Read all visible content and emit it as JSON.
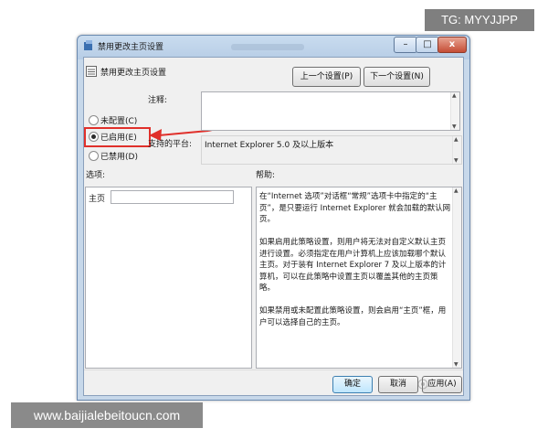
{
  "watermarks": {
    "tag": "TG: MYYJJPP",
    "url": "www.baijialebeitoucn.com"
  },
  "window": {
    "title": "禁用更改主页设置",
    "controls": {
      "minimize": "–",
      "maximize": "□",
      "close": "x"
    }
  },
  "policy": {
    "name": "禁用更改主页设置",
    "prev_button": "上一个设置(P)",
    "next_button": "下一个设置(N)"
  },
  "state": {
    "options": [
      {
        "label": "未配置(C)",
        "selected": false
      },
      {
        "label": "已启用(E)",
        "selected": true
      },
      {
        "label": "已禁用(D)",
        "selected": false
      }
    ]
  },
  "comment": {
    "label": "注释:",
    "value": ""
  },
  "supported": {
    "label": "支持的平台:",
    "value": "Internet Explorer 5.0 及以上版本"
  },
  "options_section": {
    "label": "选项:",
    "homepage_label": "主页",
    "homepage_value": ""
  },
  "help": {
    "label": "帮助:",
    "text": "在“Internet 选项”对话框“常规”选项卡中指定的“主页”，是只要运行 Internet Explorer 就会加载的默认网页。\n\n如果启用此策略设置，则用户将无法对自定义默认主页进行设置。必须指定在用户计算机上应该加载哪个默认主页。对于装有 Internet Explorer 7 及以上版本的计算机，可以在此策略中设置主页以覆盖其他的主页策略。\n\n如果禁用或未配置此策略设置，则会启用“主页”框，用户可以选择自己的主页。"
  },
  "footer": {
    "ok": "确定",
    "cancel": "取消",
    "apply": "应用(A)"
  },
  "annotation": {
    "color": "#e0302b"
  }
}
